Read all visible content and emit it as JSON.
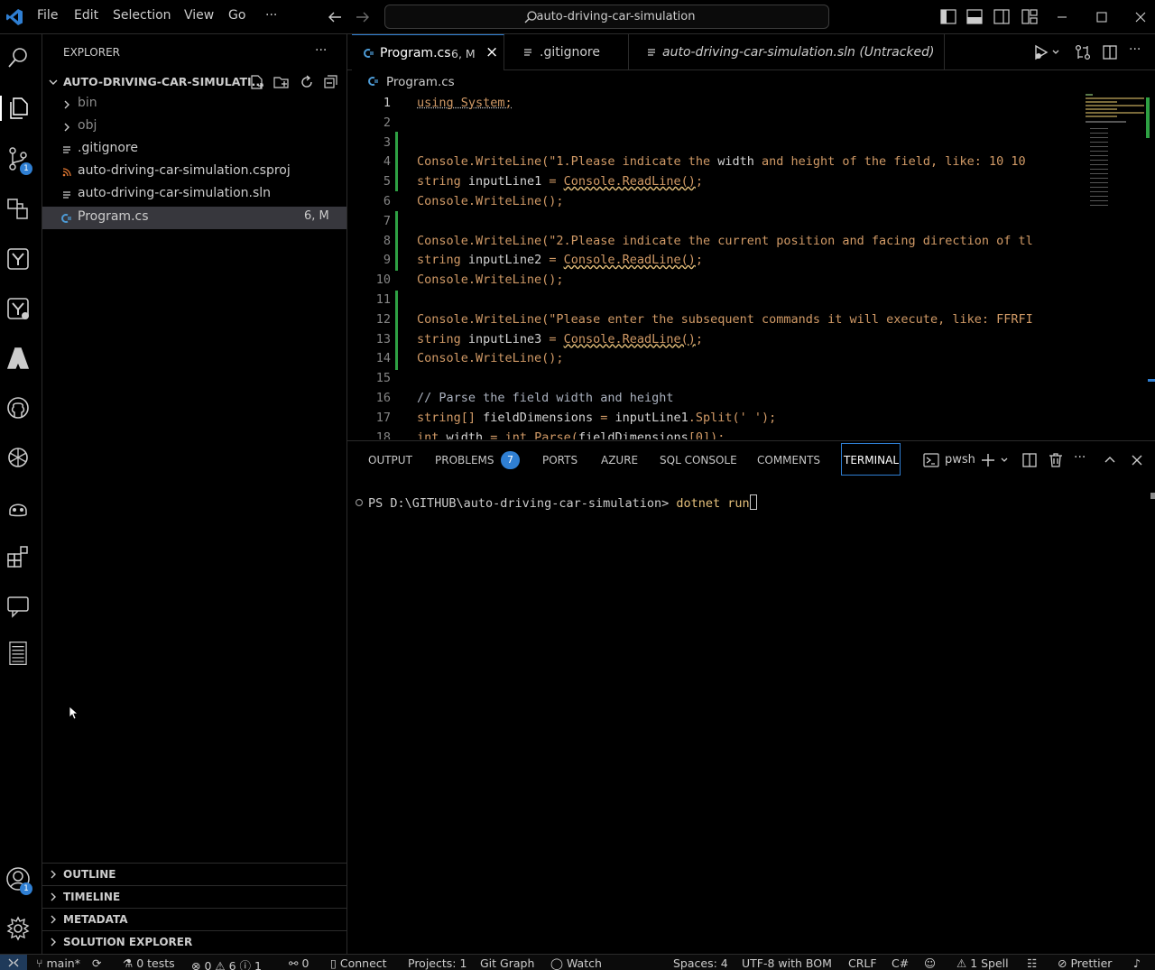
{
  "menu": [
    "File",
    "Edit",
    "Selection",
    "View",
    "Go",
    "···"
  ],
  "command_center": "auto-driving-car-simulation",
  "activity_badges": {
    "scm": "1",
    "accounts": "1"
  },
  "explorer": {
    "title": "EXPLORER",
    "more": "···",
    "root": "AUTO-DRIVING-CAR-SIMULATI...",
    "items": [
      {
        "name": "bin"
      },
      {
        "name": "obj"
      },
      {
        "name": ".gitignore"
      },
      {
        "name": "auto-driving-car-simulation.csproj"
      },
      {
        "name": "auto-driving-car-simulation.sln"
      },
      {
        "name": "Program.cs",
        "badge": "6, M"
      }
    ],
    "sections": [
      "OUTLINE",
      "TIMELINE",
      "METADATA",
      "SOLUTION EXPLORER"
    ]
  },
  "tabs": [
    {
      "label": "Program.cs",
      "meta": "6, M",
      "close": "×"
    },
    {
      "label": ".gitignore"
    },
    {
      "label": "auto-driving-car-simulation.sln (Untracked)"
    }
  ],
  "breadcrumb": "Program.cs",
  "code_lines": [
    {
      "n": "1",
      "t": "using System;"
    },
    {
      "n": "2",
      "t": ""
    },
    {
      "n": "3",
      "t": ""
    },
    {
      "n": "4",
      "t": "Console.WriteLine(\"1.Please indicate the width and height of the field, like: 10 10"
    },
    {
      "n": "5",
      "t": "string inputLine1 = Console.ReadLine();"
    },
    {
      "n": "6",
      "t": "Console.WriteLine();"
    },
    {
      "n": "7",
      "t": ""
    },
    {
      "n": "8",
      "t": "Console.WriteLine(\"2.Please indicate the current position and facing direction of tl"
    },
    {
      "n": "9",
      "t": "string inputLine2 = Console.ReadLine();"
    },
    {
      "n": "10",
      "t": "Console.WriteLine();"
    },
    {
      "n": "11",
      "t": ""
    },
    {
      "n": "12",
      "t": "Console.WriteLine(\"Please enter the subsequent commands it will execute, like: FFRFI"
    },
    {
      "n": "13",
      "t": "string inputLine3 = Console.ReadLine();"
    },
    {
      "n": "14",
      "t": "Console.WriteLine();"
    },
    {
      "n": "15",
      "t": ""
    },
    {
      "n": "16",
      "t": "// Parse the field width and height"
    },
    {
      "n": "17",
      "t": "string[] fieldDimensions = inputLine1.Split(' ');"
    },
    {
      "n": "18",
      "t": "int width = int.Parse(fieldDimensions[0]);"
    }
  ],
  "panel": {
    "tabs": [
      "OUTPUT",
      "PROBLEMS",
      "PORTS",
      "AZURE",
      "SQL CONSOLE",
      "COMMENTS",
      "TERMINAL"
    ],
    "problems_count": "7",
    "shell": "pwsh",
    "more": "···"
  },
  "terminal": {
    "prompt": "PS D:\\GITHUB\\auto-driving-car-simulation>",
    "command": "dotnet run"
  },
  "status": {
    "branch": "main*",
    "tests": "0 tests",
    "errors": "0",
    "warnings": "6",
    "infos": "1",
    "ports": "0",
    "connect": "Connect",
    "projects": "Projects: 1",
    "git_graph": "Git Graph",
    "watch": "Watch",
    "spaces": "Spaces: 4",
    "encoding": "UTF-8 with BOM",
    "eol": "CRLF",
    "language": "C#",
    "spell": "1 Spell",
    "prettier": "Prettier"
  },
  "colors": {
    "keyword": "#d19a66",
    "text": "#d4d4d4",
    "comment": "#abb2bf",
    "gutter_added": "#2ea043",
    "accent": "#2f7fd3"
  }
}
